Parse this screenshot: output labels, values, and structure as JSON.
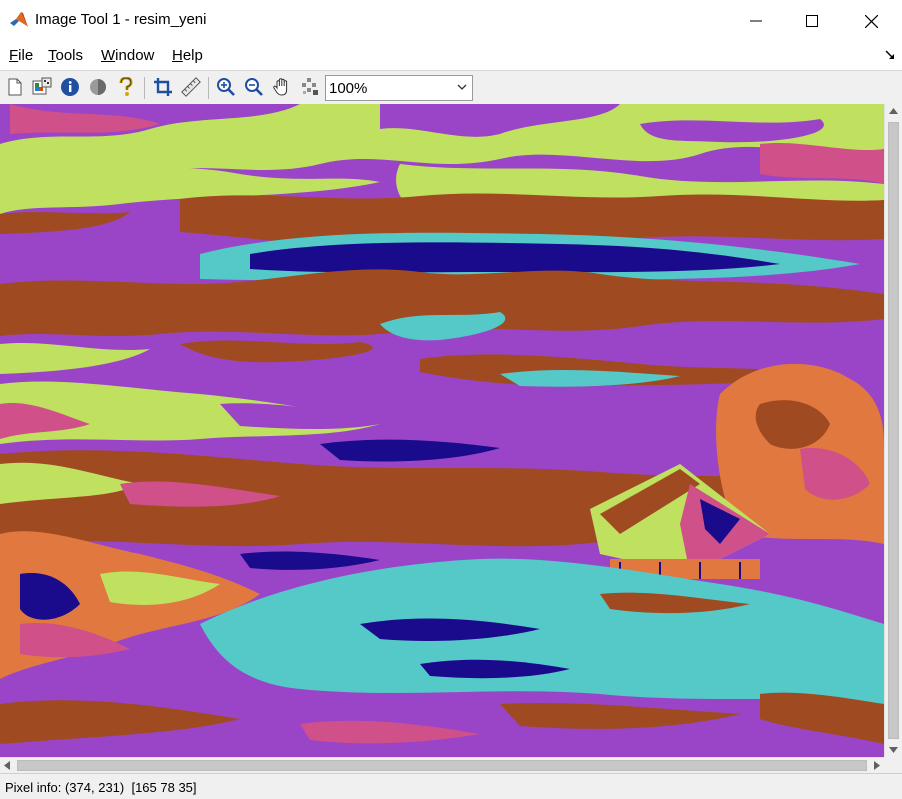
{
  "window": {
    "title": "Image Tool 1 - resim_yeni",
    "controls": [
      "minimize-icon",
      "maximize-icon",
      "close-icon"
    ]
  },
  "menu": {
    "file": {
      "underline": "F",
      "rest": "ile"
    },
    "tools": {
      "underline": "T",
      "rest": "ools"
    },
    "window": {
      "underline": "W",
      "rest": "indow"
    },
    "help": {
      "underline": "H",
      "rest": "elp"
    }
  },
  "toolbar": {
    "icons": [
      "new-figure-icon",
      "image-information-icon",
      "info-icon",
      "contrast-icon",
      "help-icon",
      "crop-icon",
      "measure-distance-icon",
      "zoom-in-icon",
      "zoom-out-icon",
      "pan-hand-icon",
      "pixel-region-icon"
    ],
    "zoom_value": "100%"
  },
  "status": {
    "pixel_info": "Pixel info: (374, 231)  [165 78 35]"
  },
  "colors": {
    "purple": "#9a45c8",
    "brown": "#a04a22",
    "yellow_green": "#c0e060",
    "cyan": "#55c8c8",
    "navy": "#1a0a8c",
    "pink": "#d0508a",
    "orange": "#e07840"
  }
}
